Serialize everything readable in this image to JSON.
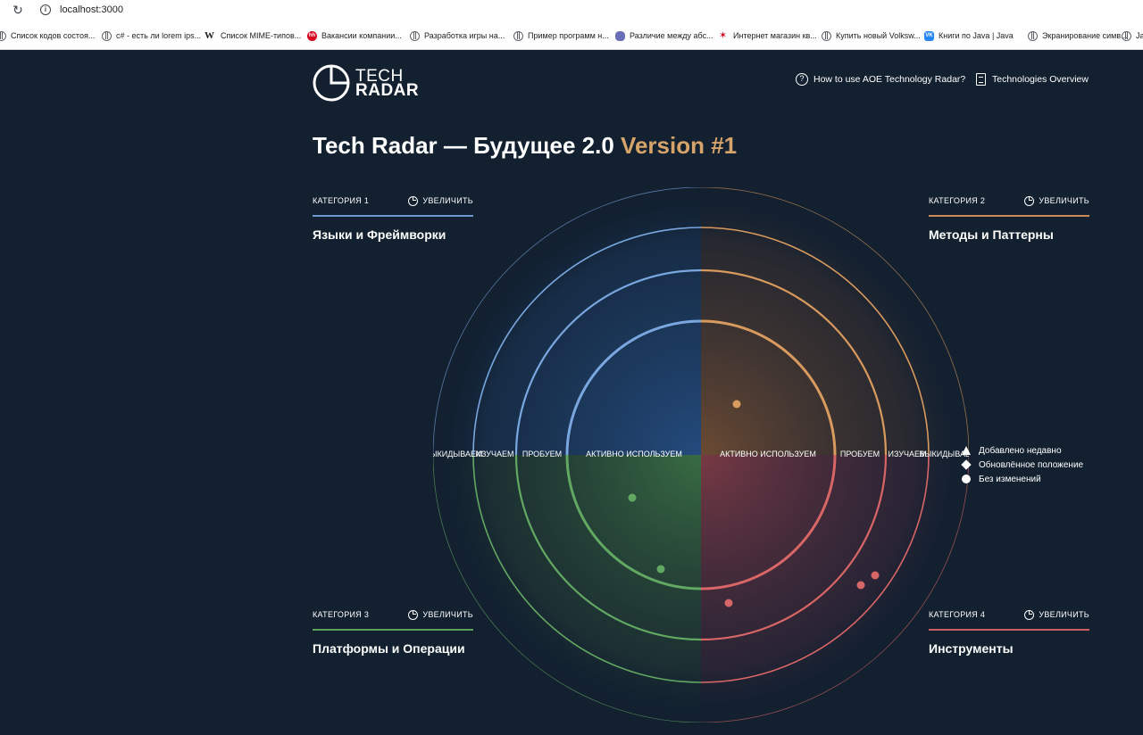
{
  "browser": {
    "url": "localhost:3000",
    "bookmarks": [
      {
        "label": "Список кодов состоя...",
        "icon": "globe"
      },
      {
        "label": "c# - есть ли lorem ips...",
        "icon": "globe"
      },
      {
        "label": "Список MIME-типов...",
        "icon": "wiki"
      },
      {
        "label": "Вакансии компании...",
        "icon": "hh"
      },
      {
        "label": "Разработка игры на...",
        "icon": "globe"
      },
      {
        "label": "Пример программ н...",
        "icon": "globe"
      },
      {
        "label": "Различие между абс...",
        "icon": "snake"
      },
      {
        "label": "Интернет магазин кв...",
        "icon": "flame"
      },
      {
        "label": "Купить новый Volksw...",
        "icon": "globe"
      },
      {
        "label": "Книги по Java | Java",
        "icon": "vk"
      },
      {
        "label": "Экранирование симв...",
        "icon": "globe"
      },
      {
        "label": "Java",
        "icon": "globe"
      }
    ]
  },
  "header": {
    "logo_top": "TECH",
    "logo_bottom": "RADAR",
    "help_link": "How to use AOE Technology Radar?",
    "overview_link": "Technologies Overview"
  },
  "title": {
    "main": "Tech Radar — Будущее 2.0",
    "version": "Version #1"
  },
  "categories": [
    {
      "label": "КАТЕГОРИЯ 1",
      "zoom": "УВЕЛИЧИТЬ",
      "name": "Языки и Фреймворки",
      "color": "#6f98d0"
    },
    {
      "label": "КАТЕГОРИЯ 2",
      "zoom": "УВЕЛИЧИТЬ",
      "name": "Методы и Паттерны",
      "color": "#c98a55"
    },
    {
      "label": "КАТЕГОРИЯ 3",
      "zoom": "УВЕЛИЧИТЬ",
      "name": "Платформы и Операции",
      "color": "#5fa05e"
    },
    {
      "label": "КАТЕГОРИЯ 4",
      "zoom": "УВЕЛИЧИТЬ",
      "name": "Инструменты",
      "color": "#c96060"
    }
  ],
  "rings": [
    "АКТИВНО ИСПОЛЬЗУЕМ",
    "ПРОБУЕМ",
    "ИЗУЧАЕМ",
    "ВЫКИДЫВАЕМ"
  ],
  "legend": [
    {
      "symbol": "triangle",
      "label": "Добавлено недавно"
    },
    {
      "symbol": "diamond",
      "label": "Обновлённое положение"
    },
    {
      "symbol": "circle",
      "label": "Без изменений"
    }
  ],
  "colors": {
    "background": "#122030",
    "q1": "#7aa7e0",
    "q2": "#d99a5e",
    "q3": "#62a862",
    "q4": "#d86666",
    "version": "#d6a36a"
  }
}
